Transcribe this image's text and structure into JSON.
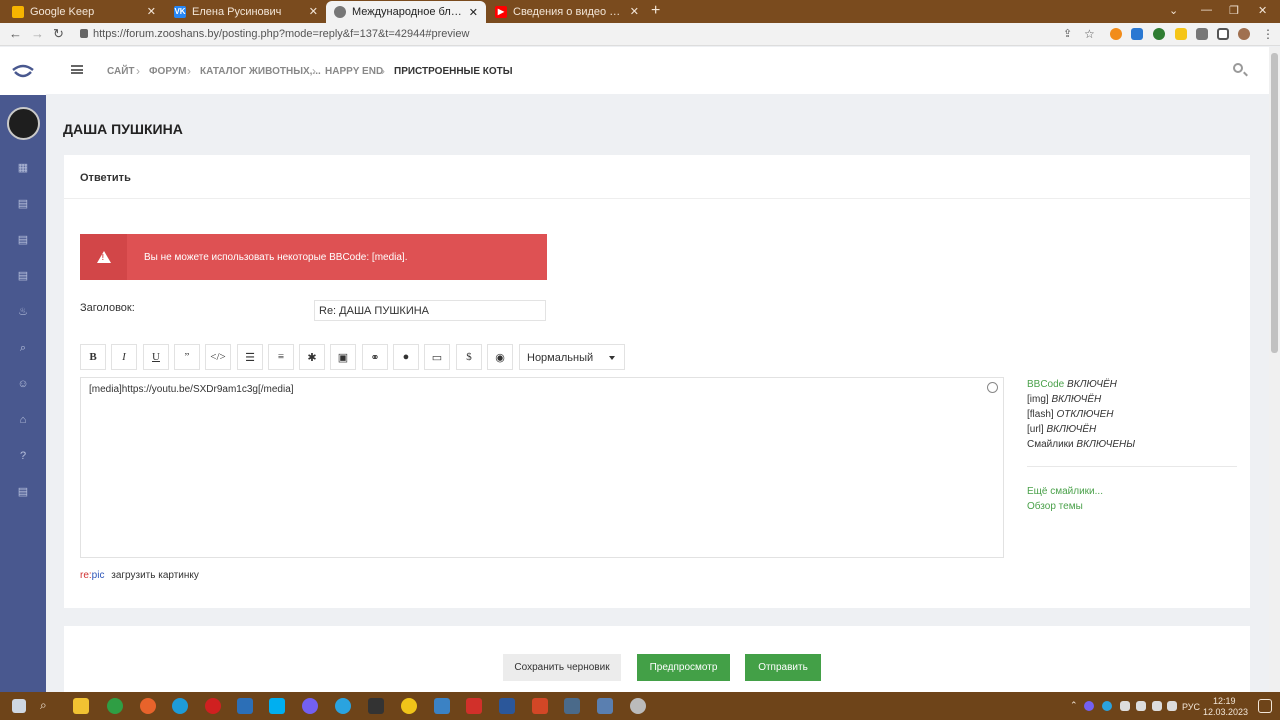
{
  "browser": {
    "tabs": [
      {
        "title": "Google Keep",
        "icon": "google-keep-icon"
      },
      {
        "title": "Елена Русинович",
        "icon": "vk-icon"
      },
      {
        "title": "Международное благотворите",
        "icon": "globe-icon"
      },
      {
        "title": "Сведения о видео - YouTube St",
        "icon": "youtube-icon"
      }
    ],
    "url": "https://forum.zooshans.by/posting.php?mode=reply&f=137&t=42944#preview"
  },
  "breadcrumb": [
    "САЙТ",
    "ФОРУМ",
    "КАТАЛОГ ЖИВОТНЫХ,...",
    "HAPPY END",
    "ПРИСТРОЕННЫЕ КОТЫ"
  ],
  "page": {
    "title": "ДАША ПУШКИНА"
  },
  "form": {
    "header": "Ответить",
    "alert": "Вы не можете использовать некоторые BBCode: [media].",
    "subject_label": "Заголовок:",
    "subject_value": "Re: ДАША ПУШКИНА",
    "toolbar_buttons": [
      {
        "label": "B",
        "name": "bold-button"
      },
      {
        "label": "I",
        "name": "italic-button"
      },
      {
        "label": "U",
        "name": "underline-button"
      },
      {
        "label": "”",
        "name": "quote-button"
      },
      {
        "label": "</>",
        "name": "code-button"
      },
      {
        "label": "☰",
        "name": "list-button"
      },
      {
        "label": "≡",
        "name": "numbered-list-button"
      },
      {
        "label": "✱",
        "name": "list-item-button"
      },
      {
        "label": "▣",
        "name": "image-button"
      },
      {
        "label": "⚭",
        "name": "link-button"
      },
      {
        "label": "●",
        "name": "color-button"
      },
      {
        "label": "▭",
        "name": "media-button"
      },
      {
        "label": "$",
        "name": "spoiler-button"
      },
      {
        "label": "◉",
        "name": "hide-button"
      }
    ],
    "font_size": "Нормальный",
    "message": "[media]https://youtu.be/SXDr9am1c3g[/media]",
    "bbcode_status": [
      {
        "label": "BBCode",
        "state": "ВКЛЮЧЁН",
        "label_link": true
      },
      {
        "label": "[img]",
        "state": "ВКЛЮЧЁН",
        "label_link": false
      },
      {
        "label": "[flash]",
        "state": "ОТКЛЮЧЕН",
        "label_link": false
      },
      {
        "label": "[url]",
        "state": "ВКЛЮЧЁН",
        "label_link": false
      },
      {
        "label": "Смайлики",
        "state": "ВКЛЮЧЕНЫ",
        "label_link": false
      }
    ],
    "more_smilies": "Ещё смайлики...",
    "topic_review": "Обзор темы",
    "repic_re": "re:",
    "repic_pic": "pic",
    "upload_image": "загрузить картинку",
    "buttons": {
      "save_draft": "Сохранить черновик",
      "preview": "Предпросмотр",
      "submit": "Отправить"
    }
  },
  "taskbar": {
    "lang": "РУС",
    "time": "12:19",
    "date": "12.03.2023"
  },
  "colors": {
    "sidebar": "#49588f",
    "alert": "#de5153",
    "accent_green": "#43a047",
    "browser_frame": "#7a4b1e"
  }
}
